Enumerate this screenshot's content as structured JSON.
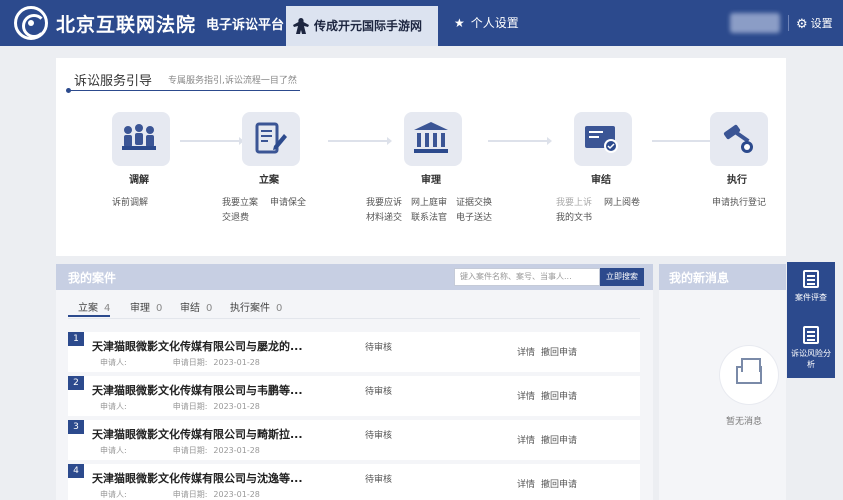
{
  "header": {
    "court_name": "北京互联网法院",
    "platform_name": "电子诉讼平台",
    "watermark_text": "传成开元国际手游网",
    "personal_settings": "个人设置",
    "settings": "设置"
  },
  "guide": {
    "title": "诉讼服务引导",
    "subtitle": "专属服务指引,诉讼流程一目了然",
    "steps": [
      {
        "label": "调解",
        "icon": "people-meeting-icon"
      },
      {
        "label": "立案",
        "icon": "document-edit-icon"
      },
      {
        "label": "审理",
        "icon": "courthouse-icon"
      },
      {
        "label": "审结",
        "icon": "certificate-icon"
      },
      {
        "label": "执行",
        "icon": "gavel-icon"
      }
    ],
    "links": {
      "mediation": [
        "诉前调解"
      ],
      "filing": [
        "我要立案",
        "申请保全",
        "交退费"
      ],
      "trial": [
        "我要应诉",
        "网上庭审",
        "证据交换",
        "材料递交",
        "联系法官",
        "电子送达"
      ],
      "closing": [
        "我要上诉",
        "网上阅卷",
        "我的文书"
      ],
      "execution": [
        "申请执行登记"
      ]
    }
  },
  "cases": {
    "title": "我的案件",
    "search_placeholder": "键入案件名称、案号、当事人...",
    "search_button": "立即搜索",
    "tabs": [
      {
        "label": "立案",
        "count": "4"
      },
      {
        "label": "审理",
        "count": "0"
      },
      {
        "label": "审结",
        "count": "0"
      },
      {
        "label": "执行案件",
        "count": "0"
      }
    ],
    "applicant_label": "申请人:",
    "date_label": "申请日期:",
    "detail_label": "详情",
    "withdraw_label": "撤回申请",
    "rows": [
      {
        "num": "1",
        "title": "天津猫眼微影文化传媒有限公司与屡龙的...",
        "date": "2023-01-28",
        "status": "待审核"
      },
      {
        "num": "2",
        "title": "天津猫眼微影文化传媒有限公司与韦鹏等...",
        "date": "2023-01-28",
        "status": "待审核"
      },
      {
        "num": "3",
        "title": "天津猫眼微影文化传媒有限公司与畸斯拉...",
        "date": "2023-01-28",
        "status": "待审核"
      },
      {
        "num": "4",
        "title": "天津猫眼微影文化传媒有限公司与沈逸等...",
        "date": "2023-01-28",
        "status": "待审核"
      }
    ]
  },
  "messages": {
    "title": "我的新消息",
    "empty_text": "暂无消息"
  },
  "float_buttons": {
    "evaluation": "案件评查",
    "risk": "诉讼风险分析"
  },
  "colors": {
    "primary": "#2c4a8d",
    "panel_header": "#c7cfe3",
    "background": "#eceef2"
  }
}
